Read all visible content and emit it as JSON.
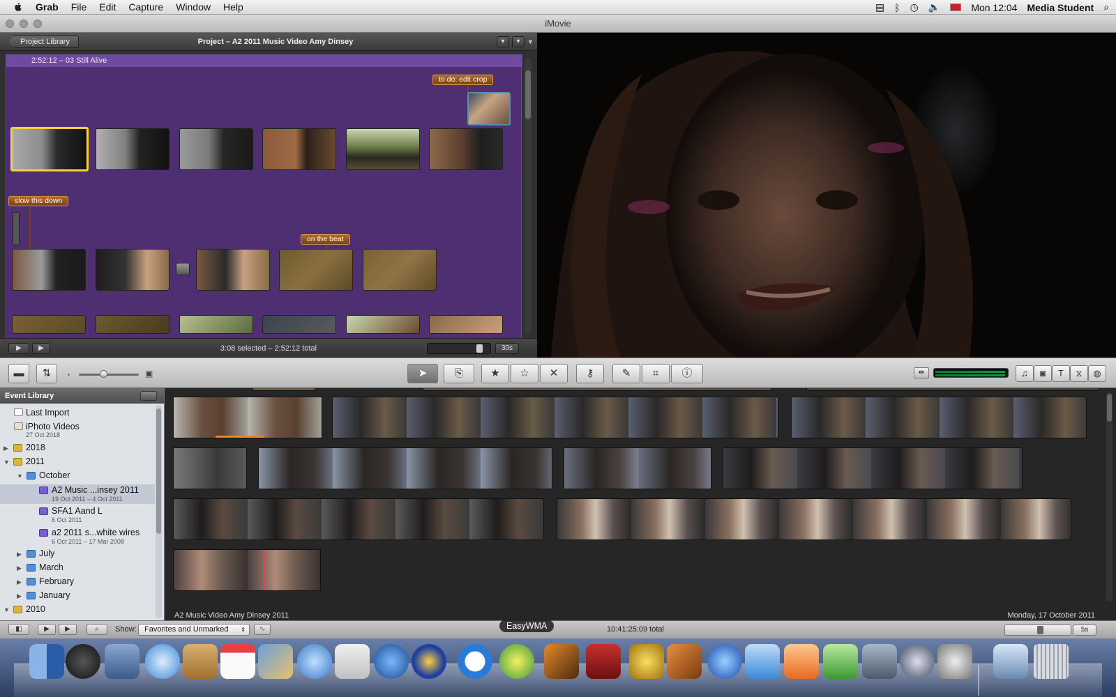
{
  "menubar": {
    "app_name": "Grab",
    "items": [
      "File",
      "Edit",
      "Capture",
      "Window",
      "Help"
    ],
    "clock": "Mon 12:04",
    "user": "Media Student"
  },
  "window": {
    "title": "iMovie"
  },
  "project": {
    "library_button": "Project Library",
    "title": "Project – A2 2011 Music Video Amy Dinsey",
    "clip_label": "2:52:12 – 03 Still Alive",
    "notes": {
      "edit_crop": "to do: edit crop",
      "slow_down": "slow this down",
      "on_beat": "on the beat"
    },
    "status": "3:08 selected – 2:52:12 total",
    "zoom_value": "30s"
  },
  "event_library": {
    "header": "Event Library",
    "items": [
      {
        "label": "Last Import"
      },
      {
        "label": "iPhoto Videos",
        "sub": "27 Oct 2018"
      },
      {
        "label": "2018"
      },
      {
        "label": "2011"
      },
      {
        "label": "October"
      },
      {
        "label": "A2 Music ...insey 2011",
        "sub": "19 Oct 2011 – 4 Oct 2011"
      },
      {
        "label": "SFA1 Aand L",
        "sub": "6 Oct 2011"
      },
      {
        "label": "a2 2011 s...white wires",
        "sub": "6 Oct 2011 – 17 Mar 2008"
      },
      {
        "label": "July"
      },
      {
        "label": "March"
      },
      {
        "label": "February"
      },
      {
        "label": "January"
      },
      {
        "label": "2010"
      }
    ]
  },
  "event_browser": {
    "event_name": "A2 Music Video Amy Dinsey 2011",
    "event_date": "Monday, 17 October 2011"
  },
  "bottom_bar": {
    "show_label": "Show:",
    "show_value": "Favorites and Unmarked",
    "total": "10:41:25:09 total",
    "zoom_value": "5s"
  },
  "dock": {
    "tooltip": "EasyWMA"
  },
  "colors": {
    "project_bg": "#4e2f72",
    "note_bg": "#9a5820",
    "selection": "#f6d23a"
  }
}
